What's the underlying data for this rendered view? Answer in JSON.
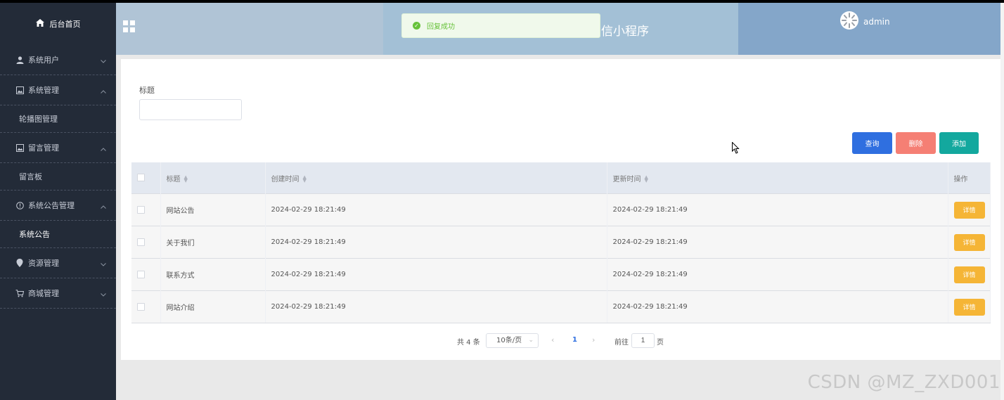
{
  "sidebar": {
    "home_label": "后台首页",
    "groups": [
      {
        "label": "系统用户",
        "icon": "user-icon",
        "expanded": false,
        "children": []
      },
      {
        "label": "系统管理",
        "icon": "image-icon",
        "expanded": true,
        "children": [
          {
            "label": "轮播图管理",
            "active": false
          }
        ]
      },
      {
        "label": "留言管理",
        "icon": "image-icon",
        "expanded": true,
        "children": [
          {
            "label": "留言板",
            "active": false
          }
        ]
      },
      {
        "label": "系统公告管理",
        "icon": "info-circle-icon",
        "expanded": true,
        "children": [
          {
            "label": "系统公告",
            "active": true
          }
        ]
      },
      {
        "label": "资源管理",
        "icon": "location-pin-icon",
        "expanded": false,
        "children": []
      },
      {
        "label": "商城管理",
        "icon": "cart-icon",
        "expanded": false,
        "children": []
      }
    ]
  },
  "header": {
    "app_title": "信小程序",
    "user_name": "admin"
  },
  "toast": {
    "message": "回复成功",
    "type": "success"
  },
  "search": {
    "title_label": "标题",
    "title_value": ""
  },
  "actions": {
    "query_label": "查询",
    "delete_label": "删除",
    "add_label": "添加"
  },
  "table": {
    "columns": {
      "title": "标题",
      "created": "创建时间",
      "updated": "更新时间",
      "ops": "操作"
    },
    "detail_label": "详情",
    "rows": [
      {
        "title": "网站公告",
        "created": "2024-02-29 18:21:49",
        "updated": "2024-02-29 18:21:49"
      },
      {
        "title": "关于我们",
        "created": "2024-02-29 18:21:49",
        "updated": "2024-02-29 18:21:49"
      },
      {
        "title": "联系方式",
        "created": "2024-02-29 18:21:49",
        "updated": "2024-02-29 18:21:49"
      },
      {
        "title": "网站介绍",
        "created": "2024-02-29 18:21:49",
        "updated": "2024-02-29 18:21:49"
      }
    ]
  },
  "pagination": {
    "total_text": "共 4 条",
    "page_size": "10条/页",
    "current_page": "1",
    "goto_label": "前往",
    "goto_value": "1",
    "page_suffix": "页"
  },
  "watermark": "CSDN @MZ_ZXD001",
  "colors": {
    "sidebar_bg": "#232b38",
    "primary": "#2f6fe0",
    "danger": "#f57f74",
    "success": "#13a89e",
    "warning": "#f5b536"
  }
}
